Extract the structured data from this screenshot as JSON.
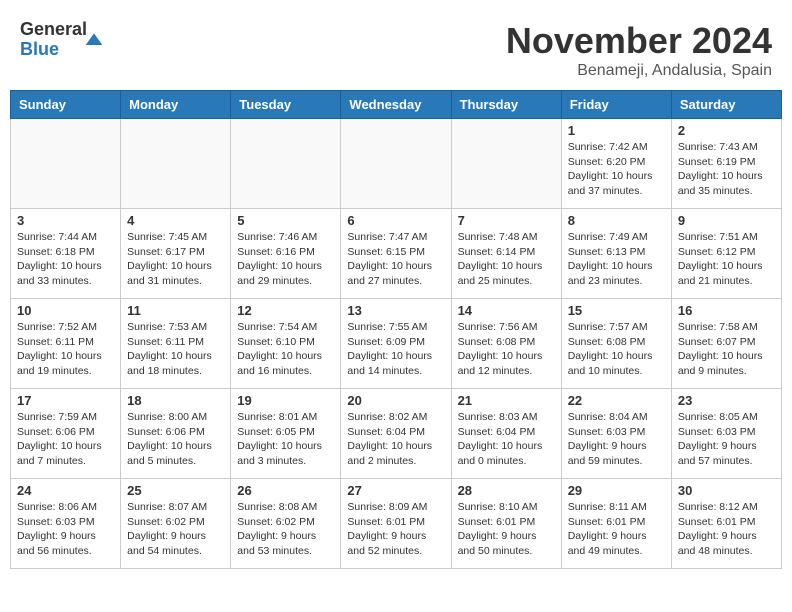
{
  "logo": {
    "general": "General",
    "blue": "Blue"
  },
  "title": {
    "month": "November 2024",
    "location": "Benameji, Andalusia, Spain"
  },
  "weekdays": [
    "Sunday",
    "Monday",
    "Tuesday",
    "Wednesday",
    "Thursday",
    "Friday",
    "Saturday"
  ],
  "weeks": [
    [
      {
        "day": "",
        "info": ""
      },
      {
        "day": "",
        "info": ""
      },
      {
        "day": "",
        "info": ""
      },
      {
        "day": "",
        "info": ""
      },
      {
        "day": "",
        "info": ""
      },
      {
        "day": "1",
        "info": "Sunrise: 7:42 AM\nSunset: 6:20 PM\nDaylight: 10 hours and 37 minutes."
      },
      {
        "day": "2",
        "info": "Sunrise: 7:43 AM\nSunset: 6:19 PM\nDaylight: 10 hours and 35 minutes."
      }
    ],
    [
      {
        "day": "3",
        "info": "Sunrise: 7:44 AM\nSunset: 6:18 PM\nDaylight: 10 hours and 33 minutes."
      },
      {
        "day": "4",
        "info": "Sunrise: 7:45 AM\nSunset: 6:17 PM\nDaylight: 10 hours and 31 minutes."
      },
      {
        "day": "5",
        "info": "Sunrise: 7:46 AM\nSunset: 6:16 PM\nDaylight: 10 hours and 29 minutes."
      },
      {
        "day": "6",
        "info": "Sunrise: 7:47 AM\nSunset: 6:15 PM\nDaylight: 10 hours and 27 minutes."
      },
      {
        "day": "7",
        "info": "Sunrise: 7:48 AM\nSunset: 6:14 PM\nDaylight: 10 hours and 25 minutes."
      },
      {
        "day": "8",
        "info": "Sunrise: 7:49 AM\nSunset: 6:13 PM\nDaylight: 10 hours and 23 minutes."
      },
      {
        "day": "9",
        "info": "Sunrise: 7:51 AM\nSunset: 6:12 PM\nDaylight: 10 hours and 21 minutes."
      }
    ],
    [
      {
        "day": "10",
        "info": "Sunrise: 7:52 AM\nSunset: 6:11 PM\nDaylight: 10 hours and 19 minutes."
      },
      {
        "day": "11",
        "info": "Sunrise: 7:53 AM\nSunset: 6:11 PM\nDaylight: 10 hours and 18 minutes."
      },
      {
        "day": "12",
        "info": "Sunrise: 7:54 AM\nSunset: 6:10 PM\nDaylight: 10 hours and 16 minutes."
      },
      {
        "day": "13",
        "info": "Sunrise: 7:55 AM\nSunset: 6:09 PM\nDaylight: 10 hours and 14 minutes."
      },
      {
        "day": "14",
        "info": "Sunrise: 7:56 AM\nSunset: 6:08 PM\nDaylight: 10 hours and 12 minutes."
      },
      {
        "day": "15",
        "info": "Sunrise: 7:57 AM\nSunset: 6:08 PM\nDaylight: 10 hours and 10 minutes."
      },
      {
        "day": "16",
        "info": "Sunrise: 7:58 AM\nSunset: 6:07 PM\nDaylight: 10 hours and 9 minutes."
      }
    ],
    [
      {
        "day": "17",
        "info": "Sunrise: 7:59 AM\nSunset: 6:06 PM\nDaylight: 10 hours and 7 minutes."
      },
      {
        "day": "18",
        "info": "Sunrise: 8:00 AM\nSunset: 6:06 PM\nDaylight: 10 hours and 5 minutes."
      },
      {
        "day": "19",
        "info": "Sunrise: 8:01 AM\nSunset: 6:05 PM\nDaylight: 10 hours and 3 minutes."
      },
      {
        "day": "20",
        "info": "Sunrise: 8:02 AM\nSunset: 6:04 PM\nDaylight: 10 hours and 2 minutes."
      },
      {
        "day": "21",
        "info": "Sunrise: 8:03 AM\nSunset: 6:04 PM\nDaylight: 10 hours and 0 minutes."
      },
      {
        "day": "22",
        "info": "Sunrise: 8:04 AM\nSunset: 6:03 PM\nDaylight: 9 hours and 59 minutes."
      },
      {
        "day": "23",
        "info": "Sunrise: 8:05 AM\nSunset: 6:03 PM\nDaylight: 9 hours and 57 minutes."
      }
    ],
    [
      {
        "day": "24",
        "info": "Sunrise: 8:06 AM\nSunset: 6:03 PM\nDaylight: 9 hours and 56 minutes."
      },
      {
        "day": "25",
        "info": "Sunrise: 8:07 AM\nSunset: 6:02 PM\nDaylight: 9 hours and 54 minutes."
      },
      {
        "day": "26",
        "info": "Sunrise: 8:08 AM\nSunset: 6:02 PM\nDaylight: 9 hours and 53 minutes."
      },
      {
        "day": "27",
        "info": "Sunrise: 8:09 AM\nSunset: 6:01 PM\nDaylight: 9 hours and 52 minutes."
      },
      {
        "day": "28",
        "info": "Sunrise: 8:10 AM\nSunset: 6:01 PM\nDaylight: 9 hours and 50 minutes."
      },
      {
        "day": "29",
        "info": "Sunrise: 8:11 AM\nSunset: 6:01 PM\nDaylight: 9 hours and 49 minutes."
      },
      {
        "day": "30",
        "info": "Sunrise: 8:12 AM\nSunset: 6:01 PM\nDaylight: 9 hours and 48 minutes."
      }
    ]
  ]
}
